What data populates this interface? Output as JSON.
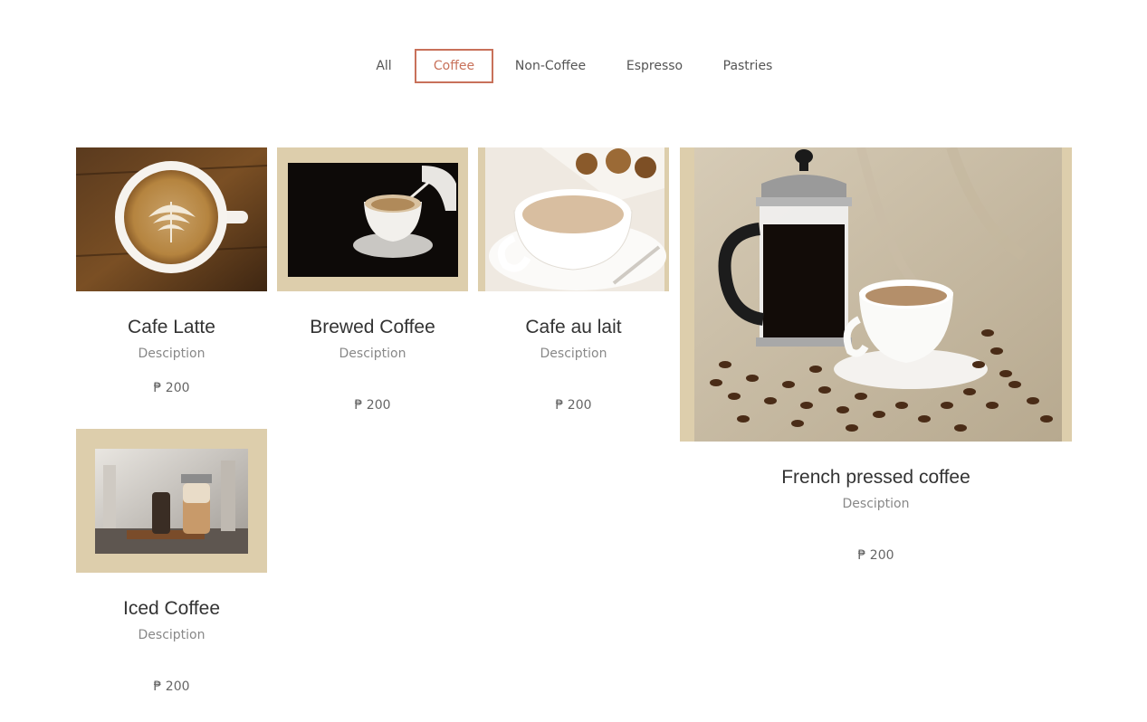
{
  "filters": {
    "all": "All",
    "coffee": "Coffee",
    "non_coffee": "Non-Coffee",
    "espresso": "Espresso",
    "pastries": "Pastries",
    "active": "Coffee"
  },
  "products": [
    {
      "name": "Cafe Latte",
      "description": "Desciption",
      "price": "₱ 200"
    },
    {
      "name": "Brewed Coffee",
      "description": "Desciption",
      "price": "₱ 200"
    },
    {
      "name": "Cafe au lait",
      "description": "Desciption",
      "price": "₱ 200"
    },
    {
      "name": "French pressed coffee",
      "description": "Desciption",
      "price": "₱ 200"
    },
    {
      "name": "Iced Coffee",
      "description": "Desciption",
      "price": "₱ 200"
    }
  ],
  "colors": {
    "accent": "#c8715a",
    "frame": "#ddceac",
    "text": "#333333",
    "muted": "#888888"
  }
}
